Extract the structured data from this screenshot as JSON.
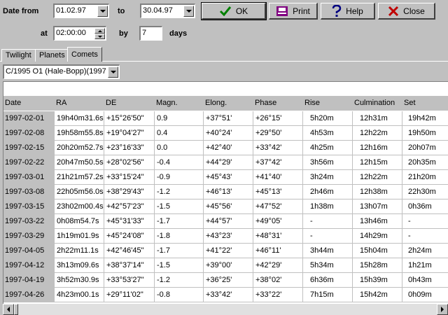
{
  "form": {
    "date_from_label": "Date from",
    "date_from_value": "01.02.97",
    "to_label": "to",
    "date_to_value": "30.04.97",
    "at_label": "at",
    "time_value": "02:00:00",
    "by_label": "by",
    "step_value": "7",
    "days_label": "days"
  },
  "buttons": {
    "ok": "OK",
    "print": "Print",
    "help": "Help",
    "close": "Close"
  },
  "tabs": [
    "Twilight",
    "Planets",
    "Comets"
  ],
  "active_tab": "Comets",
  "comet_select": "C/1995 O1 (Hale-Bopp)(1997",
  "table": {
    "headers": [
      "Date",
      "RA",
      "DE",
      "Magn.",
      "Elong.",
      "Phase",
      "Rise",
      "Culmination",
      "Set"
    ],
    "rows": [
      [
        "1997-02-01",
        "19h40m31.6s",
        "+15°26'50\"",
        "0.9",
        "+37°51'",
        "+26°15'",
        "5h20m",
        "12h31m",
        "19h42m"
      ],
      [
        "1997-02-08",
        "19h58m55.8s",
        "+19°04'27\"",
        "0.4",
        "+40°24'",
        "+29°50'",
        "4h53m",
        "12h22m",
        "19h50m"
      ],
      [
        "1997-02-15",
        "20h20m52.7s",
        "+23°16'33\"",
        "0.0",
        "+42°40'",
        "+33°42'",
        "4h25m",
        "12h16m",
        "20h07m"
      ],
      [
        "1997-02-22",
        "20h47m50.5s",
        "+28°02'56\"",
        "-0.4",
        "+44°29'",
        "+37°42'",
        "3h56m",
        "12h15m",
        "20h35m"
      ],
      [
        "1997-03-01",
        "21h21m57.2s",
        "+33°15'24\"",
        "-0.9",
        "+45°43'",
        "+41°40'",
        "3h24m",
        "12h22m",
        "21h20m"
      ],
      [
        "1997-03-08",
        "22h05m56.0s",
        "+38°29'43\"",
        "-1.2",
        "+46°13'",
        "+45°13'",
        "2h46m",
        "12h38m",
        "22h30m"
      ],
      [
        "1997-03-15",
        "23h02m00.4s",
        "+42°57'23\"",
        "-1.5",
        "+45°56'",
        "+47°52'",
        "1h38m",
        "13h07m",
        "0h36m"
      ],
      [
        "1997-03-22",
        "0h08m54.7s",
        "+45°31'33\"",
        "-1.7",
        "+44°57'",
        "+49°05'",
        "-",
        "13h46m",
        "-"
      ],
      [
        "1997-03-29",
        "1h19m01.9s",
        "+45°24'08\"",
        "-1.8",
        "+43°23'",
        "+48°31'",
        "-",
        "14h29m",
        "-"
      ],
      [
        "1997-04-05",
        "2h22m11.1s",
        "+42°46'45\"",
        "-1.7",
        "+41°22'",
        "+46°11'",
        "3h44m",
        "15h04m",
        "2h24m"
      ],
      [
        "1997-04-12",
        "3h13m09.6s",
        "+38°37'14\"",
        "-1.5",
        "+39°00'",
        "+42°29'",
        "5h34m",
        "15h28m",
        "1h21m"
      ],
      [
        "1997-04-19",
        "3h52m30.9s",
        "+33°53'27\"",
        "-1.2",
        "+36°25'",
        "+38°02'",
        "6h36m",
        "15h39m",
        "0h43m"
      ],
      [
        "1997-04-26",
        "4h23m00.1s",
        "+29°11'02\"",
        "-0.8",
        "+33°42'",
        "+33°22'",
        "7h15m",
        "15h42m",
        "0h09m"
      ]
    ]
  },
  "icons": {
    "ok": "check-icon",
    "print": "printer-icon",
    "help": "question-icon",
    "close": "x-icon"
  },
  "colors": {
    "ok_check": "#008000",
    "help_question": "#000080",
    "close_x": "#c00000",
    "print_icon": "#800080"
  }
}
